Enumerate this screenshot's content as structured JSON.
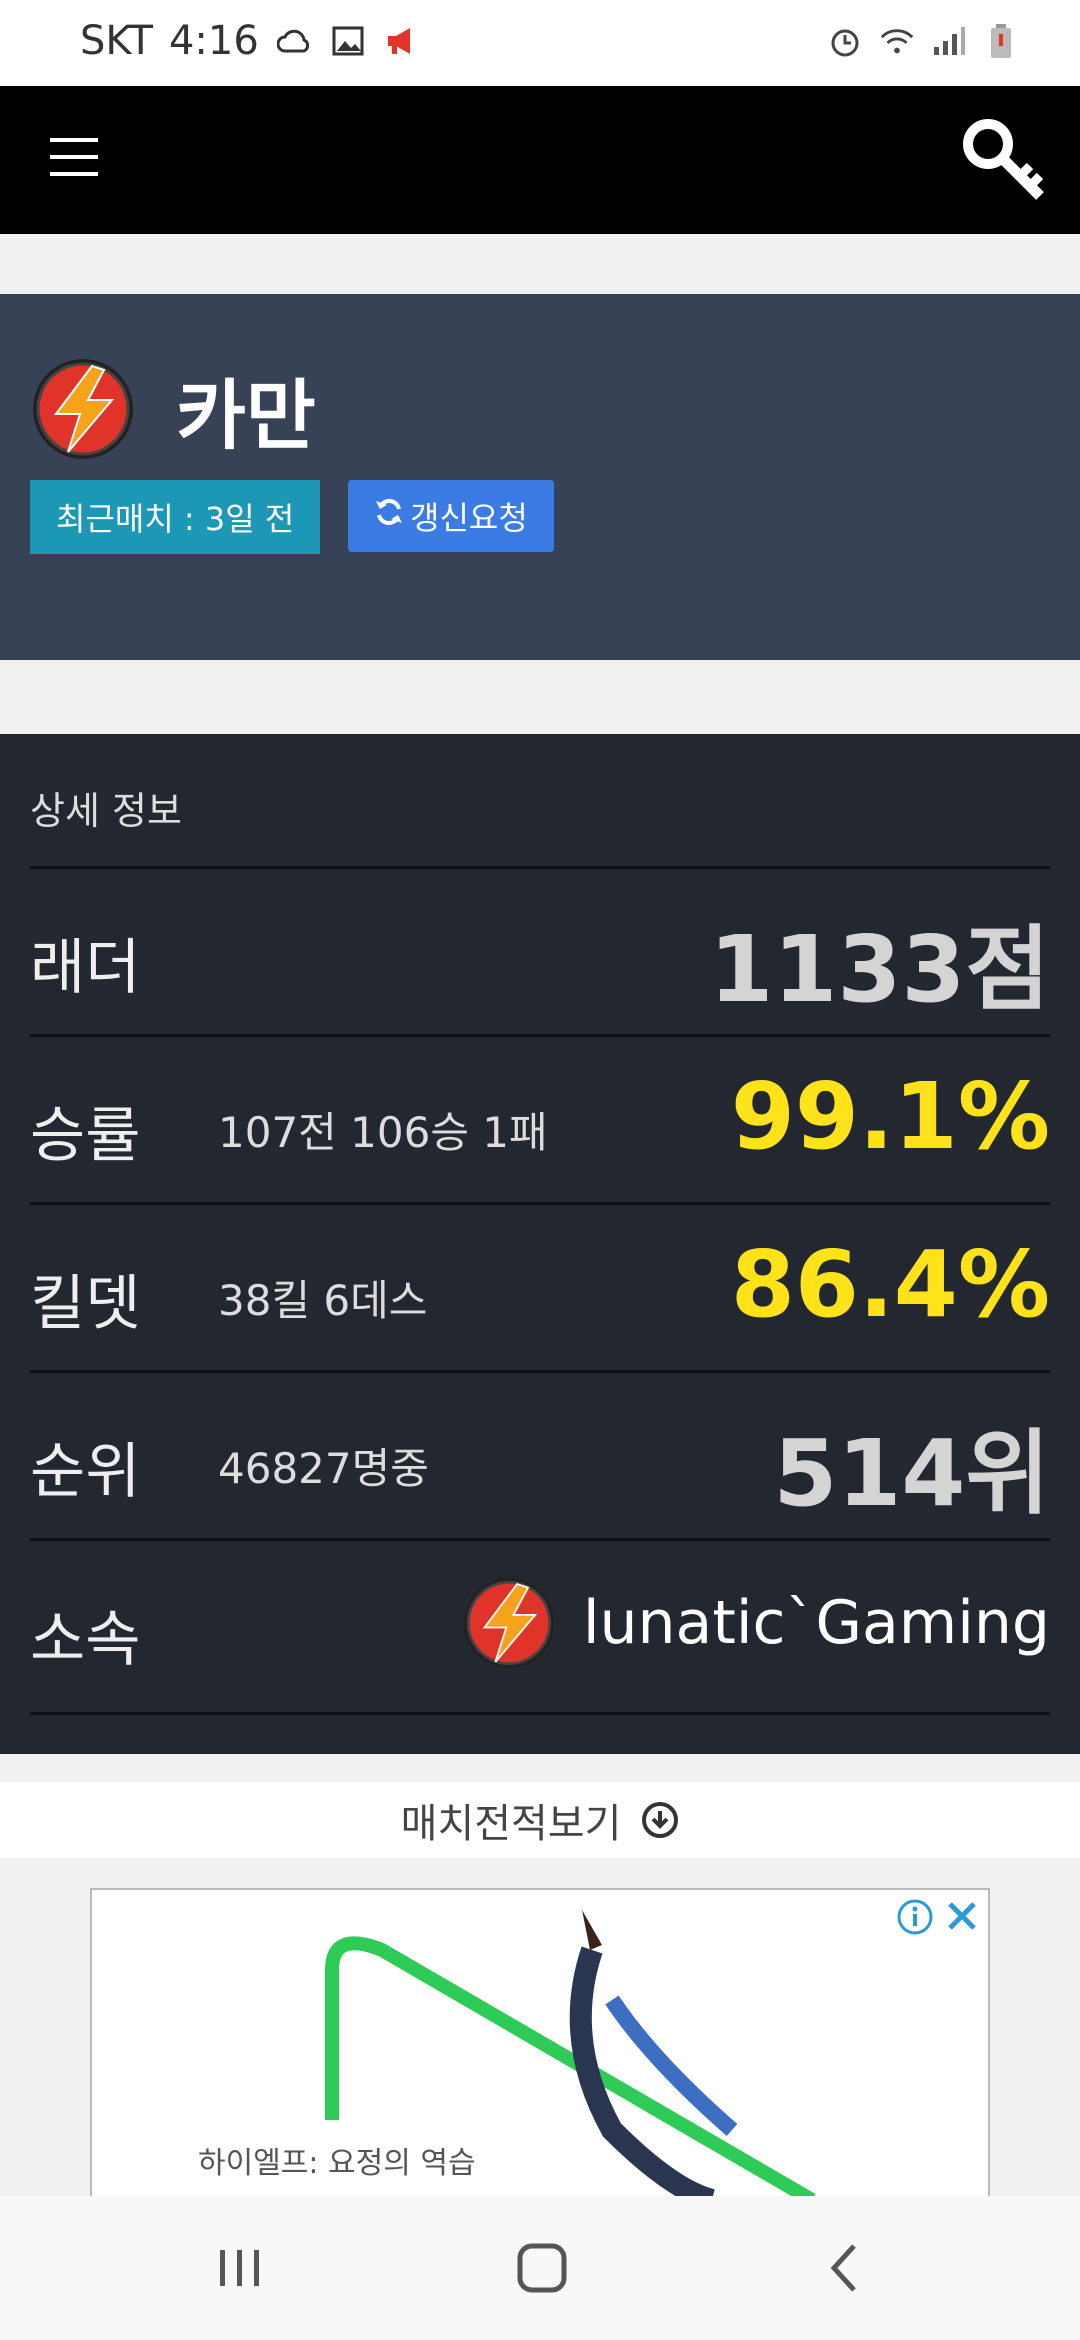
{
  "status_bar": {
    "carrier": "SKT",
    "time": "4:16"
  },
  "profile": {
    "name": "카만",
    "recent_match_label": "최근매치 : 3일 전",
    "refresh_button_label": "갱신요청"
  },
  "details": {
    "heading": "상세 정보",
    "ladder": {
      "label": "래더",
      "value": "1133점"
    },
    "winrate": {
      "label": "승률",
      "sub": "107전 106승 1패",
      "value": "99.1%"
    },
    "killdeath": {
      "label": "킬뎃",
      "sub": "38킬 6데스",
      "value": "86.4%"
    },
    "rank": {
      "label": "순위",
      "sub": "46827명중",
      "value": "514위"
    },
    "team": {
      "label": "소속",
      "name": "lunatic`Gaming"
    }
  },
  "match_history_link": "매치전적보기",
  "ad": {
    "caption": "하이엘프: 요정의 역습"
  },
  "colors": {
    "accent_yellow": "#ffe21a",
    "profile_bg": "#384256",
    "detail_bg": "#222730",
    "button_teal": "#1d97b6",
    "button_blue": "#3a7ce3"
  },
  "icons": {
    "menu": "hamburger-icon",
    "login": "key-icon",
    "guild_logo": "lightning-logo-icon",
    "refresh": "refresh-icon",
    "expand": "arrow-down-circle-icon"
  }
}
